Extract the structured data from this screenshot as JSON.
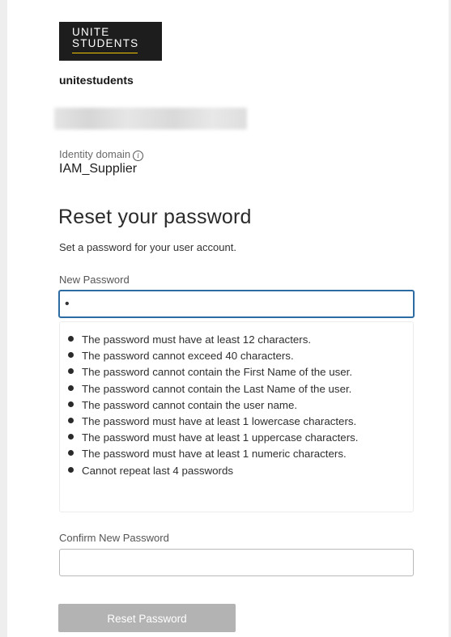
{
  "brand": {
    "logo_line1": "UNITE",
    "logo_line2": "STUDENTS",
    "logo_underline_color": "#f2c500",
    "logo_background": "#1d1d1d"
  },
  "tenant": {
    "name": "unitestudents"
  },
  "identity_domain": {
    "label": "Identity domain",
    "info_icon": "info-icon",
    "info_glyph": "i",
    "value": "IAM_Supplier"
  },
  "form": {
    "title": "Reset your password",
    "subtitle": "Set a password for your user account.",
    "new_password": {
      "label": "New Password",
      "masked_value": "•",
      "focus_border_color": "#2d6ca2"
    },
    "rules": [
      "The password must have at least 12 characters.",
      "The password cannot exceed 40 characters.",
      "The password cannot contain the First Name of the user.",
      "The password cannot contain the Last Name of the user.",
      "The password cannot contain the user name.",
      "The password must have at least 1 lowercase characters.",
      "The password must have at least 1 uppercase characters.",
      "The password must have at least 1 numeric characters.",
      "Cannot repeat last 4 passwords"
    ],
    "confirm_password": {
      "label": "Confirm New Password",
      "value": ""
    },
    "submit": {
      "label": "Reset Password",
      "disabled": true,
      "background_color": "#b3b3b3"
    }
  }
}
